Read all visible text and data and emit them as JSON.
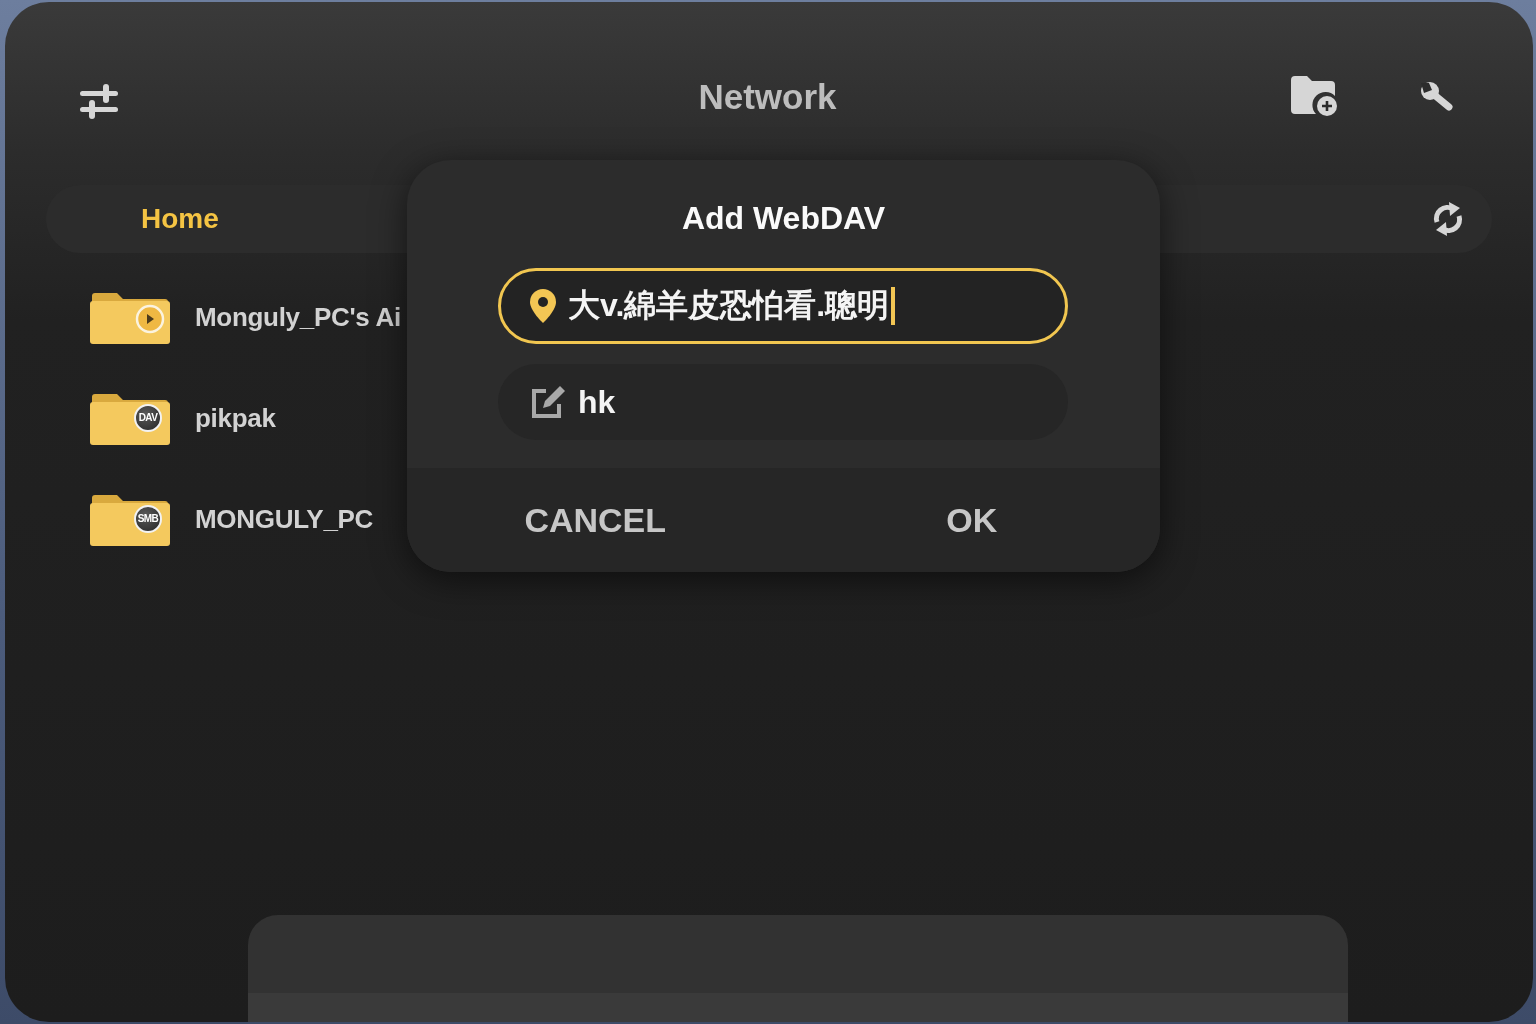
{
  "header": {
    "title": "Network"
  },
  "breadcrumb": [
    {
      "label": "Home",
      "current": true
    }
  ],
  "connections": [
    {
      "name": "Monguly_PC's Ai",
      "kind": "media"
    },
    {
      "name": "pikpak",
      "kind": "protocol",
      "badge": "DAV"
    },
    {
      "name": "MONGULY_PC",
      "kind": "protocol",
      "badge": "SMB"
    }
  ],
  "dialog": {
    "title": "Add WebDAV",
    "fields": [
      {
        "kind": "address",
        "value": "大v.綿羊皮恐怕看.聰明",
        "focused": true
      },
      {
        "kind": "name",
        "value": "hk",
        "focused": false
      }
    ],
    "buttons": [
      "CANCEL",
      "OK"
    ]
  }
}
